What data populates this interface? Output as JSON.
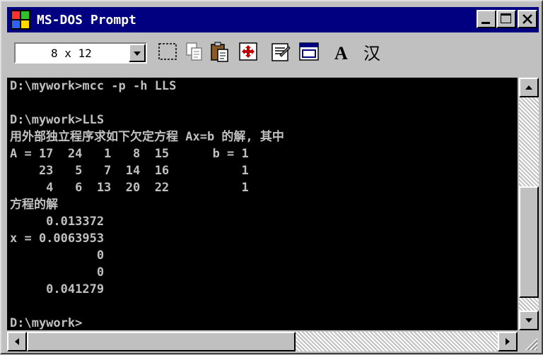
{
  "window": {
    "title": "MS-DOS Prompt",
    "icon": "ms-dos-icon"
  },
  "toolbar": {
    "font_size": "8 x 12",
    "buttons": [
      "mark-icon",
      "copy-icon",
      "paste-icon",
      "fullscreen-icon",
      "properties-icon",
      "background-icon",
      "font-icon",
      "chinese-input-icon"
    ],
    "font_button_label": "A",
    "chinese_button_label": "汉"
  },
  "console": {
    "lines": [
      "D:\\mywork>mcc -p -h LLS",
      "",
      "D:\\mywork>LLS",
      "用外部独立程序求如下欠定方程 Ax=b 的解, 其中",
      "A = 17  24   1   8  15      b = 1",
      "    23   5   7  14  16          1",
      "     4   6  13  20  22          1",
      "方程的解",
      "     0.013372",
      "x = 0.0063953",
      "            0",
      "            0",
      "     0.041279",
      "",
      "D:\\mywork>"
    ]
  },
  "colors": {
    "titlebar": "#000080",
    "console_bg": "#000000",
    "console_fg": "#c0c0c0",
    "chrome": "#c0c0c0"
  }
}
